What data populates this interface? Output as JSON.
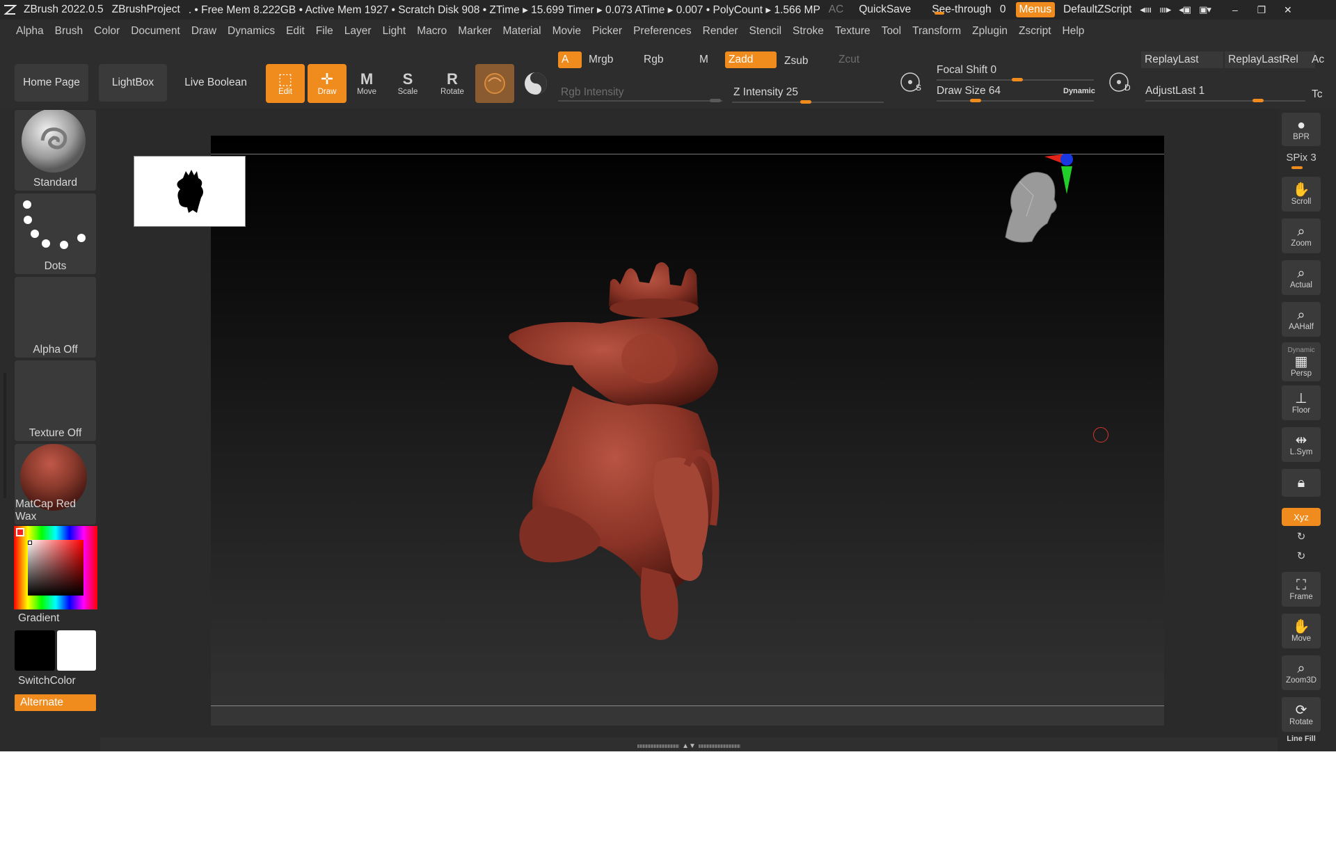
{
  "titlebar": {
    "app_version": "ZBrush 2022.0.5",
    "project": "ZBrushProject",
    "stats": ". • Free Mem 8.222GB • Active Mem 1927 • Scratch Disk 908 • ZTime ▸ 15.699 Timer ▸ 0.073 ATime ▸ 0.007 • PolyCount ▸ 1.566 MP",
    "ac": "AC",
    "quicksave": "QuickSave",
    "see_through_label": "See-through",
    "see_through_value": "0",
    "menus": "Menus",
    "script": "DefaultZScript"
  },
  "menubar": {
    "items": [
      "Alpha",
      "Brush",
      "Color",
      "Document",
      "Draw",
      "Dynamics",
      "Edit",
      "File",
      "Layer",
      "Light",
      "Macro",
      "Marker",
      "Material",
      "Movie",
      "Picker",
      "Preferences",
      "Render",
      "Stencil",
      "Stroke",
      "Texture",
      "Tool",
      "Transform",
      "Zplugin",
      "Zscript",
      "Help"
    ]
  },
  "shelf": {
    "home_page": "Home Page",
    "lightbox": "LightBox",
    "live_boolean": "Live Boolean",
    "tools": [
      {
        "label": "Edit",
        "active": true
      },
      {
        "label": "Draw",
        "active": true
      },
      {
        "label": "Move",
        "active": false
      },
      {
        "label": "Scale",
        "active": false
      },
      {
        "label": "Rotate",
        "active": false
      }
    ],
    "a_btn": "A",
    "mrgb": "Mrgb",
    "rgb": "Rgb",
    "m": "M",
    "zadd": "Zadd",
    "zsub": "Zsub",
    "zcut": "Zcut",
    "rgb_intensity": "Rgb Intensity",
    "z_intensity": "Z Intensity 25",
    "focal_shift": "Focal Shift 0",
    "draw_size": "Draw Size 64",
    "dynamic": "Dynamic",
    "replay_last": "ReplayLast",
    "replay_last_rel": "ReplayLastRel",
    "adjust_last": "AdjustLast 1",
    "ac_trunc": "Ac",
    "tc_trunc": "Tc",
    "s_label": "S",
    "d_label": "D"
  },
  "leftpanel": {
    "brush": "Standard",
    "stroke": "Dots",
    "alpha": "Alpha Off",
    "texture": "Texture Off",
    "material": "MatCap Red Wax",
    "gradient": "Gradient",
    "switch_color": "SwitchColor",
    "alternate": "Alternate"
  },
  "rightpanel": {
    "bpr": "BPR",
    "spix": "SPix 3",
    "buttons": [
      "Scroll",
      "Zoom",
      "Actual",
      "AAHalf",
      "Persp",
      "Floor",
      "L.Sym"
    ],
    "dynamic": "Dynamic",
    "xyz": "Xyz",
    "frame": "Frame",
    "move": "Move",
    "zoom3d": "Zoom3D",
    "rotate": "Rotate",
    "line_fill": "Line Fill"
  },
  "colors": {
    "accent": "#f08c1e",
    "material": "#8a3a2c",
    "background": "#2f2f2f"
  }
}
